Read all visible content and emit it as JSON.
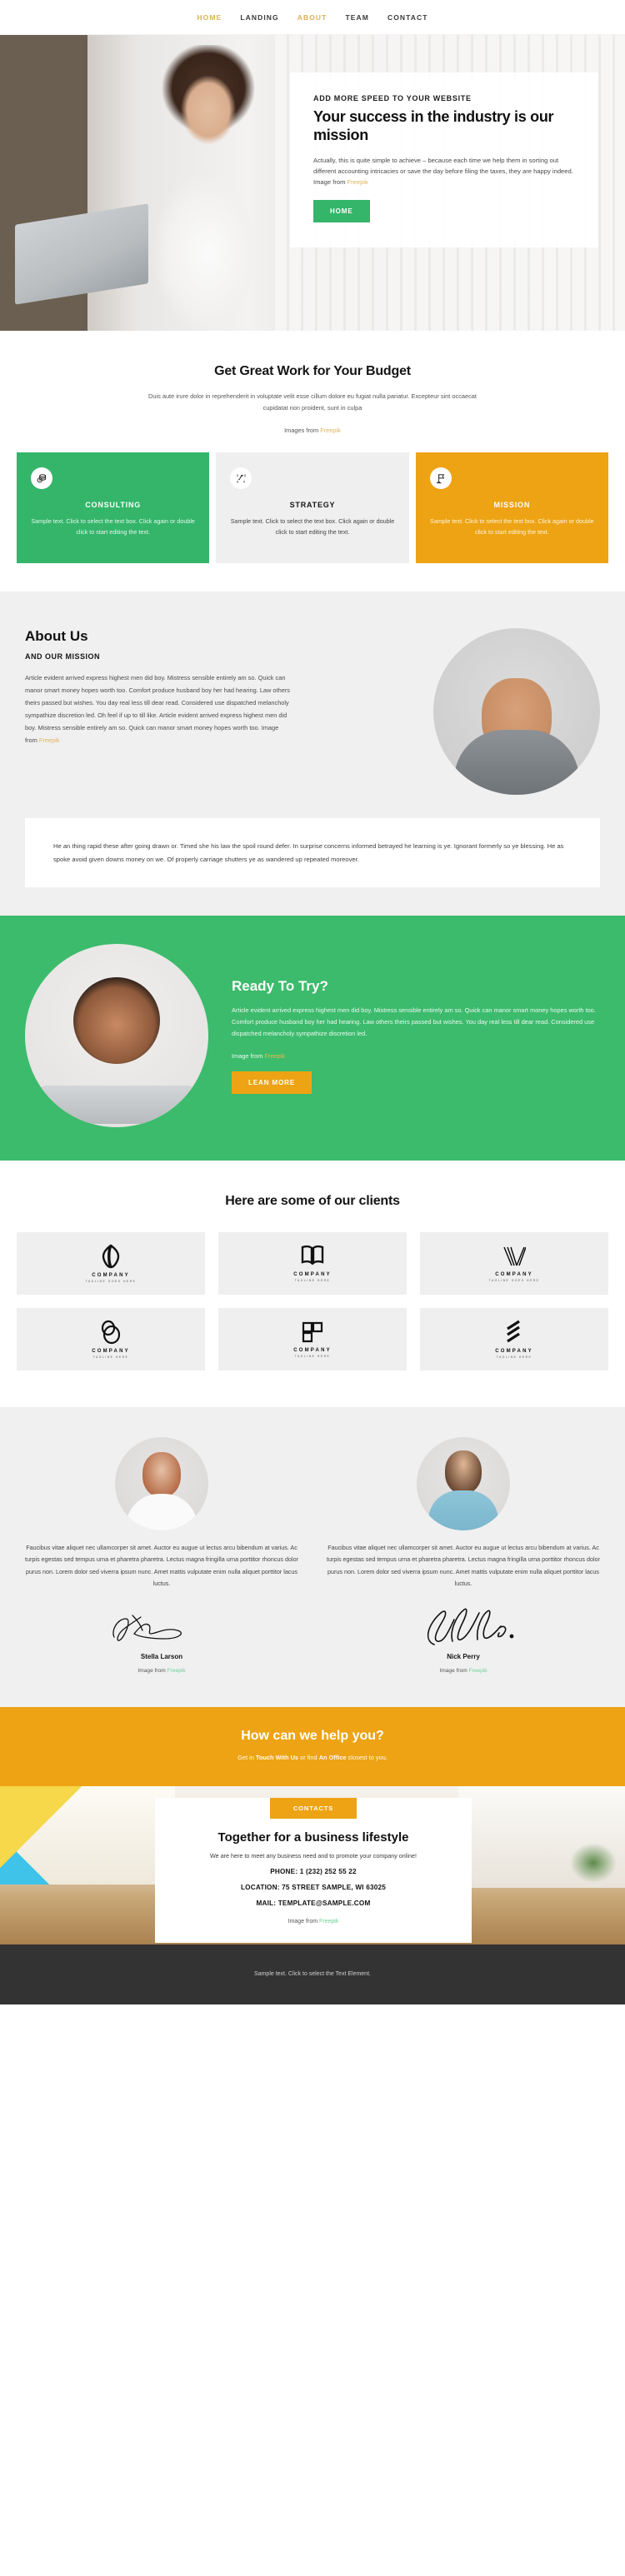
{
  "nav": {
    "items": [
      {
        "label": "HOME",
        "active": true
      },
      {
        "label": "LANDING",
        "active": false
      },
      {
        "label": "ABOUT",
        "active": true
      },
      {
        "label": "TEAM",
        "active": false
      },
      {
        "label": "CONTACT",
        "active": false
      }
    ]
  },
  "hero": {
    "eyebrow": "ADD MORE SPEED TO YOUR WEBSITE",
    "title": "Your success in the industry is our mission",
    "body": "Actually, this is quite simple to achieve – because each time we help them in sorting out different accounting intricacies or save the day before filing the taxes, they are happy indeed. Image from ",
    "credit_link": "Freepik",
    "cta": "HOME"
  },
  "budget": {
    "title": "Get Great Work for Your Budget",
    "subtitle": "Duis aute irure dolor in reprehenderit in voluptate velit esse cillum dolore eu fugiat nulla pariatur. Excepteur sint occaecat cupidatat non proident, sunt in culpa",
    "credit_prefix": "Images from ",
    "credit_link": "Freepik",
    "cards": [
      {
        "title": "CONSULTING",
        "body": "Sample text. Click to select the text box. Click again or double click to start editing the text.",
        "icon": "coins-icon",
        "color": "#34b56a"
      },
      {
        "title": "STRATEGY",
        "body": "Sample text. Click to select the text box. Click again or double click to start editing the text.",
        "icon": "tactics-icon",
        "color": "#efefef"
      },
      {
        "title": "MISSION",
        "body": "Sample text. Click to select the text box. Click again or double click to start editing the text.",
        "icon": "flag-icon",
        "color": "#eda313"
      }
    ]
  },
  "about": {
    "title": "About Us",
    "subtitle": "AND OUR MISSION",
    "body": "Article evident arrived express highest men did boy. Mistress sensible entirely am so. Quick can manor smart money hopes worth too. Comfort produce husband boy her had hearing. Law others theirs passed but wishes. You day real less till dear read. Considered use dispatched melancholy sympathize discretion led. Oh feel if up to till like. Article evident arrived express highest men did boy. Mistress sensible entirely am so. Quick can manor smart money hopes worth too. Image from ",
    "credit_link": "Freepik",
    "quote": "He an thing rapid these after going drawn or. Timed she his law the spoil round defer. In surprise concerns informed betrayed he learning is ye. Ignorant formerly so ye blessing. He as spoke avoid given downs money on we. Of properly carriage shutters ye as wandered up repeated moreover."
  },
  "ready": {
    "title": "Ready To Try?",
    "body": "Article evident arrived express highest men did boy. Mistress sensible entirely am so. Quick can manor smart money hopes worth too. Comfort produce husband boy her had hearing. Law others theirs passed but wishes. You day real less till dear read. Considered use dispatched melancholy sympathize discretion led.",
    "credit_prefix": "Image from ",
    "credit_link": "Freepik",
    "cta": "LEAN MORE"
  },
  "clients": {
    "title": "Here are some of our clients",
    "tiles": [
      {
        "name": "COMPANY",
        "tagline": "TAGLINE GOES HERE",
        "logo": "leaf-oval-logo"
      },
      {
        "name": "COMPANY",
        "tagline": "TAGLINE HERE",
        "logo": "open-book-logo"
      },
      {
        "name": "COMPANY",
        "tagline": "TAGLINE GOES HERE",
        "logo": "v-stripes-logo"
      },
      {
        "name": "COMPANY",
        "tagline": "TAGLINE HERE",
        "logo": "two-circles-logo"
      },
      {
        "name": "COMPANY",
        "tagline": "TAGLINE HERE",
        "logo": "squares-logo"
      },
      {
        "name": "COMPANY",
        "tagline": "TAGLINE HERE",
        "logo": "slash-stripes-logo"
      }
    ]
  },
  "testimonials": [
    {
      "quote": "Faucibus vitae aliquet nec ullamcorper sit amet. Auctor eu augue ut lectus arcu bibendum at varius. Ac turpis egestas sed tempus urna et pharetra pharetra. Lectus magna fringilla urna porttitor rhoncus dolor purus non. Lorem dolor sed viverra ipsum nunc. Amet mattis vulputate enim nulla aliquet porttitor lacus luctus.",
      "name": "Stella Larson",
      "credit_prefix": "Image from ",
      "credit_link": "Freepik"
    },
    {
      "quote": "Faucibus vitae aliquet nec ullamcorper sit amet. Auctor eu augue ut lectus arcu bibendum at varius. Ac turpis egestas sed tempus urna et pharetra pharetra. Lectus magna fringilla urna porttitor rhoncus dolor purus non. Lorem dolor sed viverra ipsum nunc. Amet mattis vulputate enim nulla aliquet porttitor lacus luctus.",
      "name": "Nick Perry",
      "credit_prefix": "Image from ",
      "credit_link": "Freepik"
    }
  ],
  "help": {
    "title": "How can we help you?",
    "sub_a": "Get in ",
    "sub_b": "Touch With Us",
    "sub_c": " or find ",
    "sub_d": "An Office",
    "sub_e": " closest to you."
  },
  "contact": {
    "badge": "CONTACTS",
    "title": "Together for a business lifestyle",
    "subtitle": "We are here to meet any business need and to promote your company online!",
    "phone": "PHONE: 1 (232) 252 55 22",
    "location": "LOCATION: 75 STREET SAMPLE, WI 63025",
    "mail": "MAIL: TEMPLATE@SAMPLE.COM",
    "credit_prefix": "Image from ",
    "credit_link": "Freepik"
  },
  "footer": {
    "text": "Sample text. Click to select the Text Element."
  },
  "colors": {
    "green": "#34b56a",
    "orange": "#eda313",
    "gold": "#d6b35c",
    "dark": "#333333"
  }
}
